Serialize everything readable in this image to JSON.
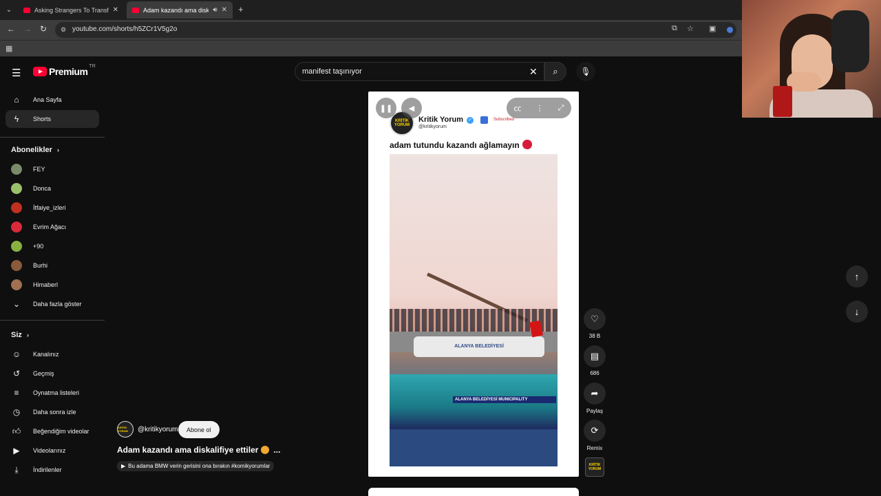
{
  "browser": {
    "tabs": [
      {
        "title": "Asking Strangers To Transform"
      },
      {
        "title": "Adam kazandı ama diskalifi"
      }
    ],
    "url": "youtube.com/shorts/h5ZCr1V5g2o"
  },
  "header": {
    "logo_text": "Premium",
    "logo_region": "TR",
    "search_value": "manifest taşınıyor"
  },
  "sidebar": {
    "main": [
      {
        "label": "Ana Sayfa",
        "icon": "home-icon"
      },
      {
        "label": "Shorts",
        "icon": "shorts-icon",
        "active": true
      }
    ],
    "subs_header": "Abonelikler",
    "subscriptions": [
      {
        "label": "FEY",
        "color": "#7a8a6a"
      },
      {
        "label": "Donca",
        "color": "#9ac06a"
      },
      {
        "label": "İtfaiye_izleri",
        "color": "#c03020"
      },
      {
        "label": "Evrim Ağacı",
        "color": "#d82a3a"
      },
      {
        "label": "+90",
        "color": "#8ab040"
      },
      {
        "label": "Burhi",
        "color": "#8a5a3a"
      },
      {
        "label": "Himaberl",
        "color": "#a07050"
      }
    ],
    "show_more": "Daha fazla göster",
    "you_header": "Siz",
    "you": [
      {
        "label": "Kanalınız",
        "icon": "user-icon"
      },
      {
        "label": "Geçmiş",
        "icon": "history-icon"
      },
      {
        "label": "Oynatma listeleri",
        "icon": "playlist-icon"
      },
      {
        "label": "Daha sonra izle",
        "icon": "clock-icon"
      },
      {
        "label": "Beğendiğim videolar",
        "icon": "like-icon"
      },
      {
        "label": "Videolarınız",
        "icon": "video-icon"
      },
      {
        "label": "İndirilenler",
        "icon": "download-icon"
      }
    ]
  },
  "short": {
    "channel_name": "Kritik Yorum",
    "channel_handle": "@kritikyorum",
    "subscribed_label": "Subscribed",
    "caption": "adam tutundu kazandı ağlamayın",
    "avatar_text": "KRİTİK YORUM"
  },
  "actions": {
    "likes": "38 B",
    "comments": "686",
    "share": "Paylaş",
    "remix": "Remix"
  },
  "overlay": {
    "handle": "@kritikyorum",
    "subscribe": "Abone ol",
    "title": "Adam kazandı ama diskalifiye ettiler",
    "more": "...",
    "description": "Bu adama BMW verin gerisini ona bırakın #komikyorumlar"
  },
  "video_text": {
    "boat_sign": "ALANYA BELEDİYESİ",
    "boat_side": "ALANYA BELEDİYESİ MUNICIPALITY"
  }
}
